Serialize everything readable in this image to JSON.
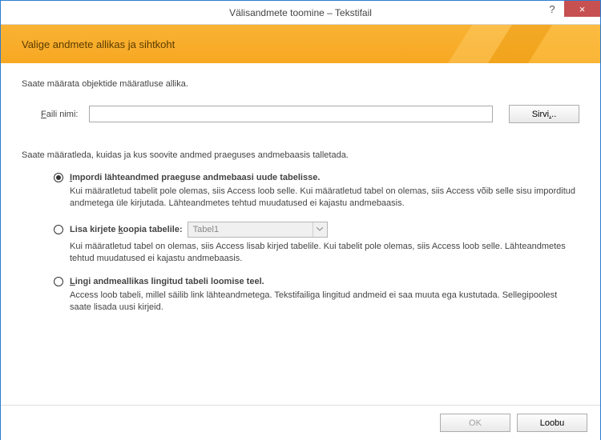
{
  "window": {
    "title": "Välisandmete toomine – Tekstifail",
    "help_tooltip": "?",
    "close_tooltip": "×"
  },
  "banner": {
    "heading": "Valige andmete allikas ja sihtkoht"
  },
  "intro": "Saate määrata objektide määratluse allika.",
  "file": {
    "label": "Faili nimi:",
    "value": "",
    "browse": "Sirvi..."
  },
  "desc": "Saate määratleda, kuidas ja kus soovite andmed praeguses andmebaasis talletada.",
  "options": [
    {
      "label": "Impordi lähteandmed praeguse andmebaasi uude tabelisse.",
      "desc": "Kui määratletud tabelit pole olemas, siis Access loob selle. Kui määratletud tabel on olemas, siis Access võib selle sisu imporditud andmetega üle kirjutada. Lähteandmetes tehtud muudatused ei kajastu andmebaasis.",
      "checked": true
    },
    {
      "label": "Lisa kirjete koopia tabelile:",
      "desc": "Kui määratletud tabel on olemas, siis Access lisab kirjed tabelile. Kui tabelit pole olemas, siis Access loob selle. Lähteandmetes tehtud muudatused ei kajastu andmebaasis.",
      "checked": false,
      "combo_value": "Tabel1"
    },
    {
      "label": "Lingi andmeallikas lingitud tabeli loomise teel.",
      "desc": "Access loob tabeli, millel säilib link lähteandmetega. Tekstifailiga lingitud andmeid ei saa muuta ega kustutada. Sellegipoolest saate lisada uusi kirjeid.",
      "checked": false
    }
  ],
  "footer": {
    "ok": "OK",
    "cancel": "Loobu"
  }
}
